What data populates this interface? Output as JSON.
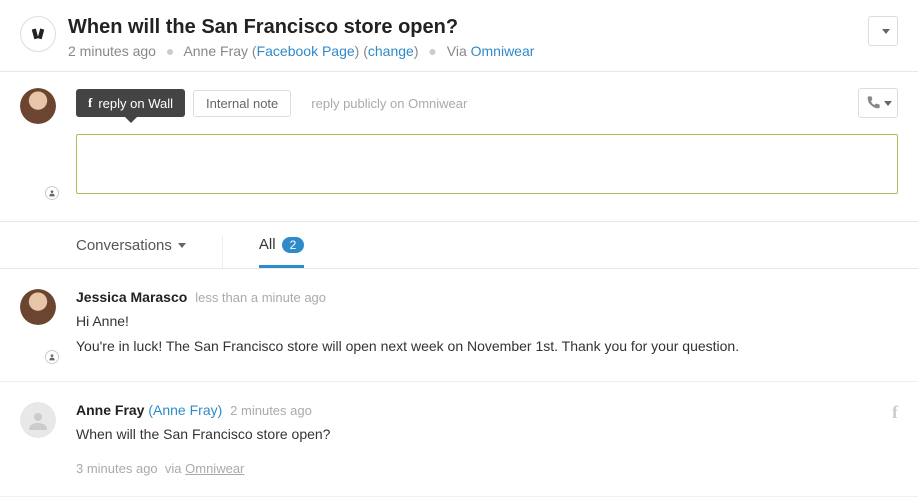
{
  "header": {
    "title": "When will the San Francisco store open?",
    "time": "2 minutes ago",
    "requester": "Anne Fray",
    "channel_label": "Facebook Page",
    "change_label": "change",
    "via_prefix": "Via",
    "via_name": "Omniwear"
  },
  "compose": {
    "reply_wall_label": "reply on Wall",
    "internal_note_label": "Internal note",
    "public_hint": "reply publicly on Omniwear",
    "textarea_value": ""
  },
  "filters": {
    "conversations_label": "Conversations",
    "all_label": "All",
    "all_count": "2"
  },
  "messages": [
    {
      "author": "Jessica Marasco",
      "author_link": "",
      "time": "less than a minute ago",
      "greeting": "Hi Anne!",
      "body": "You're in luck! The San Francisco store will open next week on November 1st. Thank you for your question.",
      "footer_time": "",
      "footer_via": ""
    },
    {
      "author": "Anne Fray",
      "author_link": "(Anne Fray)",
      "time": "2 minutes ago",
      "greeting": "",
      "body": "When will the San Francisco store open?",
      "footer_time": "3 minutes ago",
      "footer_via": "Omniwear"
    }
  ]
}
